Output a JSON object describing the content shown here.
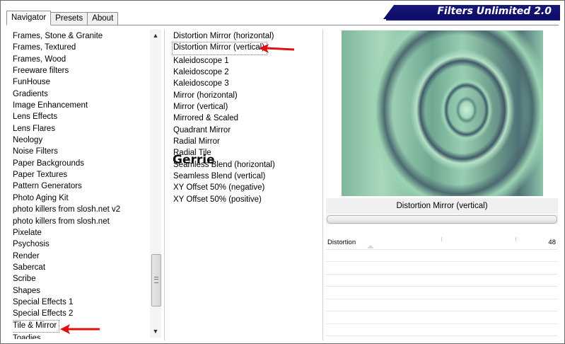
{
  "app": {
    "title": "Filters Unlimited 2.0"
  },
  "tabs": [
    {
      "label": "Navigator",
      "active": true
    },
    {
      "label": "Presets",
      "active": false
    },
    {
      "label": "About",
      "active": false
    }
  ],
  "categories": [
    "Frames, Stone & Granite",
    "Frames, Textured",
    "Frames, Wood",
    "Freeware filters",
    "FunHouse",
    "Gradients",
    "Image Enhancement",
    "Lens Effects",
    "Lens Flares",
    "Neology",
    "Noise Filters",
    "Paper Backgrounds",
    "Paper Textures",
    "Pattern Generators",
    "Photo Aging Kit",
    "photo killers from slosh.net v2",
    "photo killers from slosh.net",
    "Pixelate",
    "Psychosis",
    "Render",
    "Sabercat",
    "Scribe",
    "Shapes",
    "Special Effects 1",
    "Special Effects 2",
    "Tile & Mirror",
    "Toadies"
  ],
  "selected_category": "Tile & Mirror",
  "filters": [
    "Distortion Mirror (horizontal)",
    "Distortion Mirror (vertical)",
    "Kaleidoscope 1",
    "Kaleidoscope 2",
    "Kaleidoscope 3",
    "Mirror (horizontal)",
    "Mirror (vertical)",
    "Mirrored & Scaled",
    "Quadrant Mirror",
    "Radial Mirror",
    "Radial Tile",
    "Seamless Blend (horizontal)",
    "Seamless Blend (vertical)",
    "XY Offset 50% (negative)",
    "XY Offset 50% (positive)"
  ],
  "selected_filter": "Distortion Mirror (vertical)",
  "watermark": "Gerrie",
  "preview": {
    "filter_name": "Distortion Mirror (vertical)"
  },
  "parameters": [
    {
      "name": "Distortion",
      "value": "48"
    }
  ],
  "colors": {
    "banner": "#17177a",
    "arrow": "#e01010"
  },
  "icons": {
    "scroll_up": "triangle-up",
    "scroll_down": "triangle-down",
    "arrow": "red-pointer-arrow"
  }
}
